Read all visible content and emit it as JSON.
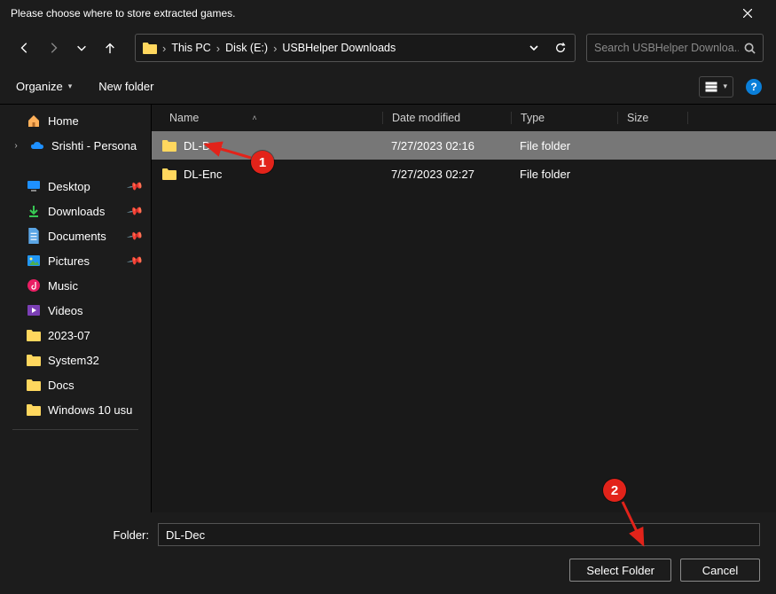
{
  "title": "Please choose where to store extracted games.",
  "breadcrumb": [
    "This PC",
    "Disk (E:)",
    "USBHelper Downloads"
  ],
  "search": {
    "placeholder": "Search USBHelper Downloa..."
  },
  "toolbar": {
    "organize": "Organize",
    "new_folder": "New folder"
  },
  "sidebar": {
    "home": "Home",
    "personal": "Srishti - Persona",
    "quick": [
      {
        "label": "Desktop",
        "icon": "desktop",
        "pin": true
      },
      {
        "label": "Downloads",
        "icon": "download",
        "pin": true
      },
      {
        "label": "Documents",
        "icon": "document",
        "pin": true
      },
      {
        "label": "Pictures",
        "icon": "pictures",
        "pin": true
      },
      {
        "label": "Music",
        "icon": "music",
        "pin": false
      },
      {
        "label": "Videos",
        "icon": "videos",
        "pin": false
      },
      {
        "label": "2023-07",
        "icon": "folder",
        "pin": false
      },
      {
        "label": "System32",
        "icon": "folder",
        "pin": false
      },
      {
        "label": "Docs",
        "icon": "folder",
        "pin": false
      },
      {
        "label": "Windows 10 usu",
        "icon": "folder",
        "pin": false
      }
    ]
  },
  "columns": {
    "name": "Name",
    "date": "Date modified",
    "type": "Type",
    "size": "Size"
  },
  "rows": [
    {
      "name": "DL-Dec",
      "date": "7/27/2023 02:16",
      "type": "File folder",
      "selected": true
    },
    {
      "name": "DL-Enc",
      "date": "7/27/2023 02:27",
      "type": "File folder",
      "selected": false
    }
  ],
  "footer": {
    "label": "Folder:",
    "value": "DL-Dec",
    "select": "Select Folder",
    "cancel": "Cancel"
  },
  "annotations": {
    "badge1": "1",
    "badge2": "2"
  }
}
